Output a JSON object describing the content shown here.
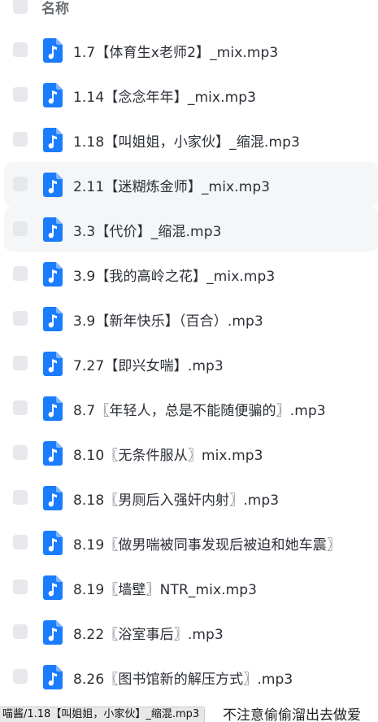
{
  "header": {
    "label": "名称"
  },
  "files": [
    {
      "name": "1.7【体育生x老师2】_mix.mp3",
      "highlighted": false
    },
    {
      "name": "1.14【念念年年】_mix.mp3",
      "highlighted": false
    },
    {
      "name": "1.18【叫姐姐，小家伙】_缩混.mp3",
      "highlighted": false
    },
    {
      "name": "2.11【迷糊炼金师】_mix.mp3",
      "highlighted": true
    },
    {
      "name": "3.3【代价】_缩混.mp3",
      "highlighted": true
    },
    {
      "name": "3.9【我的高岭之花】_mix.mp3",
      "highlighted": false
    },
    {
      "name": "3.9【新年快乐】（百合）.mp3",
      "highlighted": false
    },
    {
      "name": "7.27【即兴女喘】.mp3",
      "highlighted": false
    },
    {
      "name": "8.7〖年轻人，总是不能随便骗的〗.mp3",
      "highlighted": false
    },
    {
      "name": "8.10〖无条件服从〗mix.mp3",
      "highlighted": false
    },
    {
      "name": "8.18〖男厕后入强奸内射〗.mp3",
      "highlighted": false
    },
    {
      "name": "8.19〖做男喘被同事发现后被迫和她车震〗",
      "highlighted": false
    },
    {
      "name": "8.19〖墙壁〗NTR_mix.mp3",
      "highlighted": false
    },
    {
      "name": "8.22〖浴室事后〗.mp3",
      "highlighted": false
    },
    {
      "name": "8.26〖图书馆新的解压方式〗.mp3",
      "highlighted": false
    }
  ],
  "tooltip": {
    "path": "喵酱/1.18【叫姐姐，小家伙】_缩混.mp3",
    "trailing": "不注意偷偷溜出去做爱"
  },
  "colors": {
    "icon": "#1a7cff",
    "text": "#2b2f36",
    "checkbox": "#e6e8ec"
  },
  "icons": {
    "file": "music-note-icon"
  }
}
